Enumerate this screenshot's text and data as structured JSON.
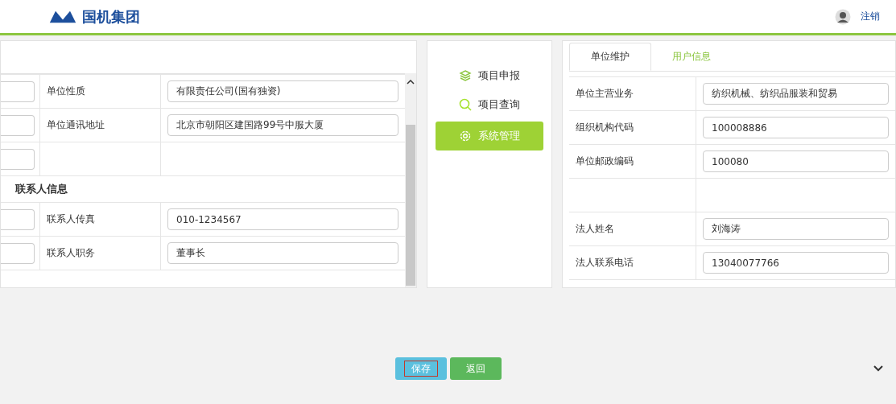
{
  "header": {
    "logo_text": "国机集团",
    "logout": "注销"
  },
  "left_form": {
    "rows": [
      {
        "kind": "field",
        "label": "单位性质",
        "value": "有限责任公司(国有独资)"
      },
      {
        "kind": "field",
        "label": "单位通讯地址",
        "value": "北京市朝阳区建国路99号中服大厦"
      },
      {
        "kind": "blank"
      },
      {
        "kind": "section",
        "title": "联系人信息"
      },
      {
        "kind": "field",
        "label": "联系人传真",
        "value": "010-1234567"
      },
      {
        "kind": "field",
        "label": "联系人职务",
        "value": "董事长"
      }
    ]
  },
  "nav": {
    "items": [
      {
        "label": "项目申报",
        "selected": false
      },
      {
        "label": "项目查询",
        "selected": false
      },
      {
        "label": "系统管理",
        "selected": true
      }
    ]
  },
  "tabs": [
    {
      "label": "单位维护",
      "selected": true
    },
    {
      "label": "用户信息",
      "selected": false
    }
  ],
  "right_form": {
    "rows": [
      {
        "kind": "field",
        "label": "单位主营业务",
        "value": "纺织机械、纺织品服装和贸易"
      },
      {
        "kind": "field",
        "label": "组织机构代码",
        "value": "100008886"
      },
      {
        "kind": "field",
        "label": "单位邮政编码",
        "value": "100080"
      },
      {
        "kind": "blank"
      },
      {
        "kind": "field",
        "label": "法人姓名",
        "value": "刘海涛"
      },
      {
        "kind": "field",
        "label": "法人联系电话",
        "value": "13040077766"
      }
    ]
  },
  "buttons": [
    {
      "label": "保存",
      "kind": "primary"
    },
    {
      "label": "返回",
      "kind": "secondary"
    }
  ]
}
